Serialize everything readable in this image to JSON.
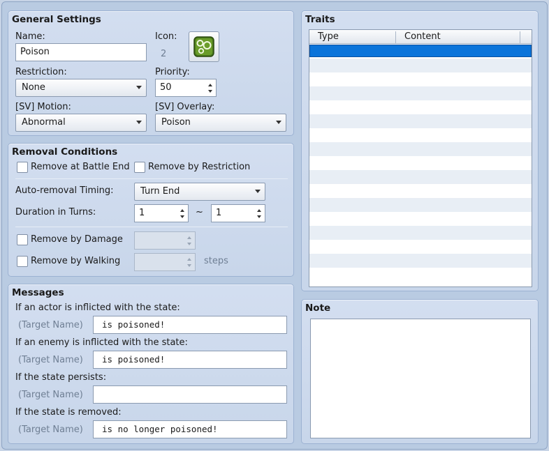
{
  "general": {
    "title": "General Settings",
    "name_label": "Name:",
    "name_value": "Poison",
    "icon_label": "Icon:",
    "icon_index": "2",
    "restriction_label": "Restriction:",
    "restriction_value": "None",
    "priority_label": "Priority:",
    "priority_value": "50",
    "motion_label": "[SV] Motion:",
    "motion_value": "Abnormal",
    "overlay_label": "[SV] Overlay:",
    "overlay_value": "Poison"
  },
  "removal": {
    "title": "Removal Conditions",
    "battle_end_label": "Remove at Battle End",
    "restriction_label": "Remove by Restriction",
    "timing_label": "Auto-removal Timing:",
    "timing_value": "Turn End",
    "duration_label": "Duration in Turns:",
    "duration_min": "1",
    "tilde": "~",
    "duration_max": "1",
    "damage_label": "Remove by Damage",
    "walking_label": "Remove by Walking",
    "steps_label": "steps"
  },
  "messages": {
    "title": "Messages",
    "target_placeholder": "(Target Name)",
    "actor_label": "If an actor is inflicted with the state:",
    "actor_value": "is poisoned!",
    "enemy_label": "If an enemy is inflicted with the state:",
    "enemy_value": "is poisoned!",
    "persists_label": "If the state persists:",
    "persists_value": "",
    "removed_label": "If the state is removed:",
    "removed_value": "is no longer poisoned!"
  },
  "traits": {
    "title": "Traits",
    "columns": [
      "Type",
      "Content"
    ],
    "selected_row": 0
  },
  "note": {
    "title": "Note",
    "value": ""
  },
  "colors": {
    "selection": "#0a74da",
    "icon_green": "#4a7a1c"
  }
}
